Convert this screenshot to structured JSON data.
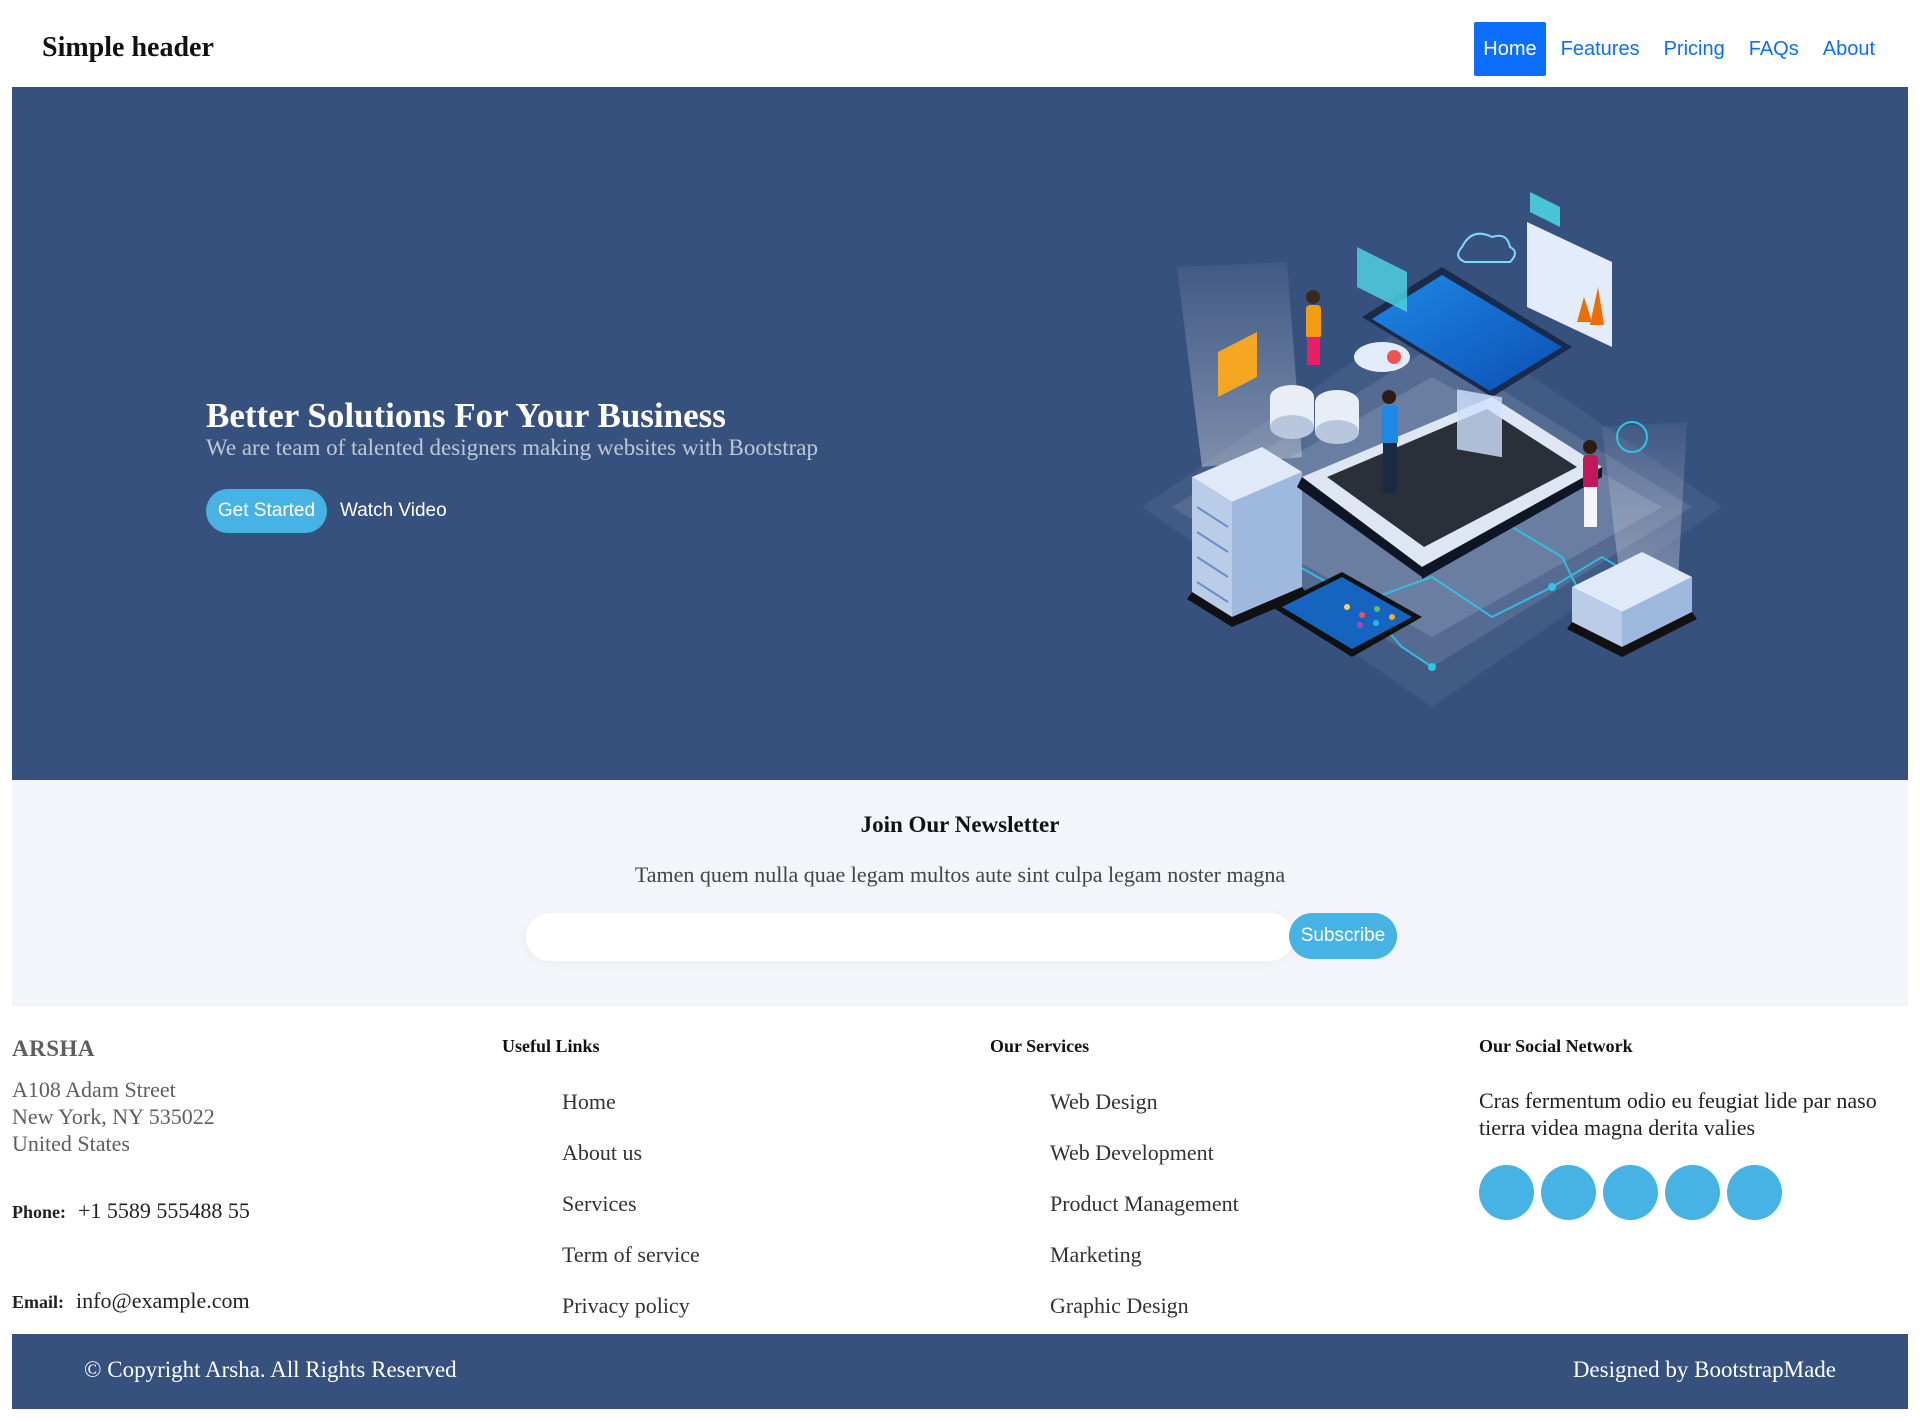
{
  "header": {
    "brand": "Simple header",
    "nav": [
      "Home",
      "Features",
      "Pricing",
      "FAQs",
      "About"
    ]
  },
  "hero": {
    "title": "Better Solutions For Your Business",
    "subtitle": "We are team of talented designers making websites with Bootstrap",
    "cta_primary": "Get Started",
    "cta_secondary": "Watch Video"
  },
  "newsletter": {
    "title": "Join Our Newsletter",
    "text": "Tamen quem nulla quae legam multos aute sint culpa legam noster magna",
    "input_placeholder": "",
    "button": "Subscribe"
  },
  "footer": {
    "brand": "ARSHA",
    "address": [
      "A108 Adam Street",
      "New York, NY 535022",
      "United States"
    ],
    "phone_label": "Phone:",
    "phone": "+1 5589 555488 55",
    "email_label": "Email:",
    "email": "info@example.com",
    "useful_links": {
      "title": "Useful Links",
      "items": [
        "Home",
        "About us",
        "Services",
        "Term of service",
        "Privacy policy"
      ]
    },
    "services": {
      "title": "Our Services",
      "items": [
        "Web Design",
        "Web Development",
        "Product Management",
        "Marketing",
        "Graphic Design"
      ]
    },
    "social": {
      "title": "Our Social Network",
      "text": "Cras fermentum odio eu feugiat lide par naso tierra videa magna derita valies",
      "icons": [
        "twitter-icon",
        "facebook-icon",
        "instagram-icon",
        "skype-icon",
        "linkedin-icon"
      ]
    },
    "copyright": "© Copyright Arsha. All Rights Reserved",
    "credits": "Designed by BootstrapMade"
  },
  "colors": {
    "hero_bg": "#37517e",
    "accent": "#47b2e4",
    "nav_active": "#0d6efd",
    "newsletter_bg": "#f3f5fa"
  }
}
